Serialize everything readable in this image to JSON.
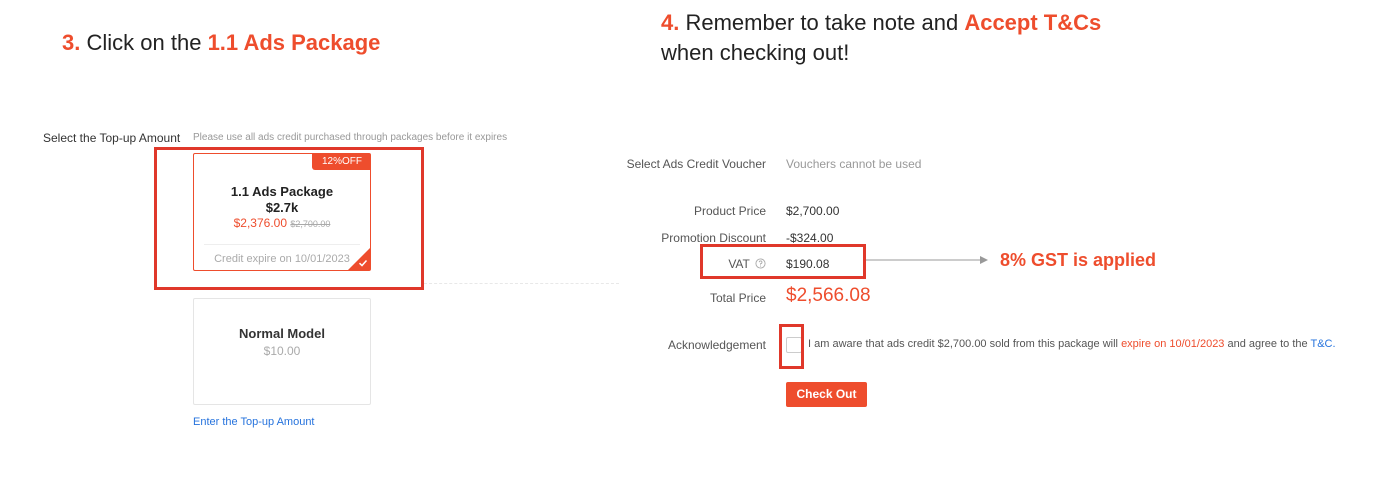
{
  "steps": {
    "step3": {
      "num": "3.",
      "text": "Click on the",
      "highlight": "1.1 Ads Package"
    },
    "step4": {
      "num": "4.",
      "text": "Remember to take note and",
      "highlight": "Accept T&Cs",
      "line2": "when checking out!"
    }
  },
  "topup": {
    "label": "Select the Top-up Amount",
    "note": "Please use all ads credit purchased through packages before it expires",
    "package": {
      "badge": "12%OFF",
      "title": "1.1 Ads Package",
      "amount": "$2.7k",
      "price": "$2,376.00",
      "original_price": "$2,700.00",
      "expire": "Credit expire on 10/01/2023"
    },
    "normal": {
      "title": "Normal Model",
      "price": "$10.00"
    },
    "enter_link": "Enter the Top-up Amount"
  },
  "checkout": {
    "voucher_label": "Select Ads Credit Voucher",
    "voucher_value": "Vouchers cannot be used",
    "product_price_label": "Product Price",
    "product_price": "$2,700.00",
    "promo_label": "Promotion Discount",
    "promo_value": "-$324.00",
    "vat_label": "VAT",
    "vat_value": "$190.08",
    "gst_note": "8% GST is applied",
    "total_label": "Total Price",
    "total_value": "$2,566.08",
    "ack_label": "Acknowledgement",
    "ack_text_1": "I am aware that ads credit $2,700.00 sold from this package will",
    "ack_expire": "expire on 10/01/2023",
    "ack_text_2": "and agree to the",
    "ack_tc": "T&C.",
    "checkout_button": "Check Out"
  },
  "colors": {
    "accent": "#ee4d2d",
    "annotation": "#e0382a",
    "link": "#2673dd"
  },
  "icons": {
    "help": "help-circle-icon",
    "check": "checkmark-icon",
    "arrow": "arrow-right-icon"
  }
}
